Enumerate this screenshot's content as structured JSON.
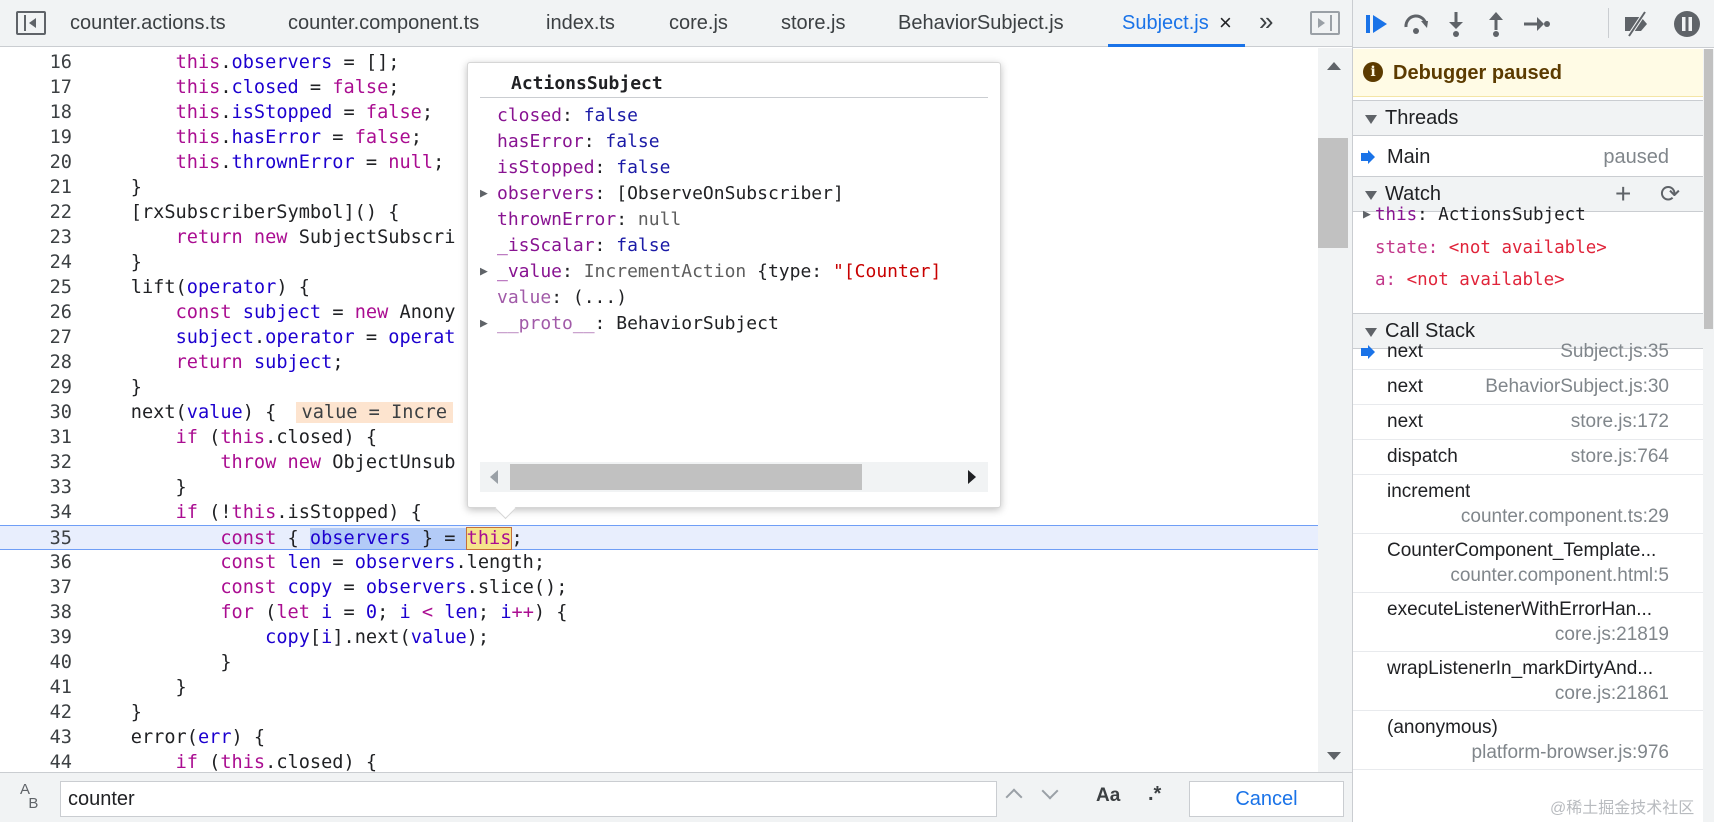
{
  "tabs": [
    {
      "label": "counter.actions.ts"
    },
    {
      "label": "counter.component.ts"
    },
    {
      "label": "index.ts"
    },
    {
      "label": "core.js"
    },
    {
      "label": "store.js"
    },
    {
      "label": "BehaviorSubject.js"
    },
    {
      "label": "Subject.js",
      "active": true,
      "close": "×"
    }
  ],
  "tabs_more": "»",
  "editor": {
    "lines": [
      {
        "n": "16",
        "html": "        <span class='kw'>this</span>.<span class='vb'>observers</span> = [];"
      },
      {
        "n": "17",
        "html": "        <span class='kw'>this</span>.<span class='vb'>closed</span> = <span class='kw'>false</span>;"
      },
      {
        "n": "18",
        "html": "        <span class='kw'>this</span>.<span class='vb'>isStopped</span> = <span class='kw'>false</span>;"
      },
      {
        "n": "19",
        "html": "        <span class='kw'>this</span>.<span class='vb'>hasError</span> = <span class='kw'>false</span>;"
      },
      {
        "n": "20",
        "html": "        <span class='kw'>this</span>.<span class='vb'>thrownError</span> = <span class='kw'>null</span>;"
      },
      {
        "n": "21",
        "html": "    }"
      },
      {
        "n": "22",
        "html": "    [rxSubscriberSymbol]() {"
      },
      {
        "n": "23",
        "html": "        <span class='kw'>return new</span> SubjectSubscri"
      },
      {
        "n": "24",
        "html": "    }"
      },
      {
        "n": "25",
        "html": "    lift(<span class='vb'>operator</span>) {"
      },
      {
        "n": "26",
        "html": "        <span class='kw'>const</span> <span class='vb'>subject</span> = <span class='kw'>new</span> Anony"
      },
      {
        "n": "27",
        "html": "        <span class='vb'>subject</span>.<span class='vb'>operator</span> = <span class='vb'>operat</span>"
      },
      {
        "n": "28",
        "html": "        <span class='kw'>return</span> <span class='vb'>subject</span>;"
      },
      {
        "n": "29",
        "html": "    }"
      },
      {
        "n": "30",
        "html": "    next(<span class='vb'>value</span>) { <span class='inline-val'>value = Incre</span>"
      },
      {
        "n": "31",
        "html": "        <span class='kw'>if</span> (<span class='kw'>this</span>.closed) {"
      },
      {
        "n": "32",
        "html": "            <span class='kw'>throw new</span> ObjectUnsub"
      },
      {
        "n": "33",
        "html": "        }"
      },
      {
        "n": "34",
        "html": "        <span class='kw'>if</span> (!<span class='kw'>this</span>.isStopped) {"
      },
      {
        "n": "35",
        "html": "            <span class='kw'>const</span> { <span class='hl-sel'><span class='vb'>observers</span> } = </span><span class='hl-this kw'>this</span>;",
        "exec": true
      },
      {
        "n": "36",
        "html": "            <span class='kw'>const</span> <span class='vb'>len</span> = <span class='vb'>observers</span>.length;"
      },
      {
        "n": "37",
        "html": "            <span class='kw'>const</span> <span class='vb'>copy</span> = <span class='vb'>observers</span>.slice();"
      },
      {
        "n": "38",
        "html": "            <span class='kw'>for</span> (<span class='kw'>let</span> <span class='vb'>i</span> = <span class='vb'>0</span>; <span class='vb'>i</span> <span class='kw'>&lt;</span> <span class='vb'>len</span>; <span class='vb'>i</span><span class='kw'>++</span>) {"
      },
      {
        "n": "39",
        "html": "                <span class='vb'>copy</span>[<span class='vb'>i</span>].next(<span class='vb'>value</span>);"
      },
      {
        "n": "40",
        "html": "            }"
      },
      {
        "n": "41",
        "html": "        }"
      },
      {
        "n": "42",
        "html": "    }"
      },
      {
        "n": "43",
        "html": "    error(<span class='vb'>err</span>) {"
      },
      {
        "n": "44",
        "html": "        <span class='kw'>if</span> (<span class='kw'>this</span>.closed) {"
      }
    ]
  },
  "popover": {
    "title": "ActionsSubject",
    "props": [
      {
        "expandable": false,
        "key": "closed",
        "value": "false",
        "vtype": "bool"
      },
      {
        "expandable": false,
        "key": "hasError",
        "value": "false",
        "vtype": "bool"
      },
      {
        "expandable": false,
        "key": "isStopped",
        "value": "false",
        "vtype": "bool"
      },
      {
        "expandable": true,
        "key": "observers",
        "value": "[ObserveOnSubscriber]",
        "vtype": "obj"
      },
      {
        "expandable": false,
        "key": "thrownError",
        "value": "null",
        "vtype": "null"
      },
      {
        "expandable": false,
        "key": "_isScalar",
        "value": "false",
        "vtype": "bool"
      },
      {
        "expandable": true,
        "key": "_value",
        "value": "IncrementAction",
        "extra": " {type: ",
        "str": "\"[Counter]",
        "vtype": "cls"
      },
      {
        "expandable": false,
        "key": "value",
        "value": "(...)",
        "vtype": "obj",
        "dim": true
      },
      {
        "expandable": true,
        "key": "__proto__",
        "value": "BehaviorSubject",
        "vtype": "obj",
        "dim": true
      }
    ]
  },
  "search": {
    "value": "counter",
    "match_case": "Aa",
    "regex": ".*",
    "cancel": "Cancel",
    "icon_text": "A\n  B"
  },
  "debugger": {
    "banner": "Debugger paused",
    "threads": {
      "title": "Threads",
      "rows": [
        {
          "name": "Main",
          "status": "paused"
        }
      ]
    },
    "watch": {
      "title": "Watch",
      "add": "+",
      "refresh": "⟳",
      "rows": [
        {
          "key": "this",
          "value": "ActionsSubject",
          "expandable": true
        },
        {
          "key": "state",
          "value": "<not available>",
          "expandable": false
        },
        {
          "key": "a",
          "value": "<not available>",
          "expandable": false
        }
      ]
    },
    "callstack": {
      "title": "Call Stack",
      "frames": [
        {
          "fn": "next",
          "loc": "Subject.js:35",
          "current": true
        },
        {
          "fn": "next",
          "loc": "BehaviorSubject.js:30"
        },
        {
          "fn": "next",
          "loc": "store.js:172"
        },
        {
          "fn": "dispatch",
          "loc": "store.js:764"
        },
        {
          "fn": "increment",
          "loc": "counter.component.ts:29",
          "twoline": true
        },
        {
          "fn": "CounterComponent_Template...",
          "loc": "counter.component.html:5",
          "twoline": true
        },
        {
          "fn": "executeListenerWithErrorHan...",
          "loc": "core.js:21819",
          "twoline": true
        },
        {
          "fn": "wrapListenerIn_markDirtyAnd...",
          "loc": "core.js:21861",
          "twoline": true
        },
        {
          "fn": "(anonymous)",
          "loc": "platform-browser.js:976",
          "twoline": true
        }
      ]
    }
  },
  "watermark": "@稀土掘金技术社区",
  "colors": {
    "accent": "#1a73e8",
    "keyword": "#aa0d91",
    "variable": "#1c00cf",
    "paused_banner_bg": "#fffbe5",
    "not_available": "#e0243a"
  }
}
